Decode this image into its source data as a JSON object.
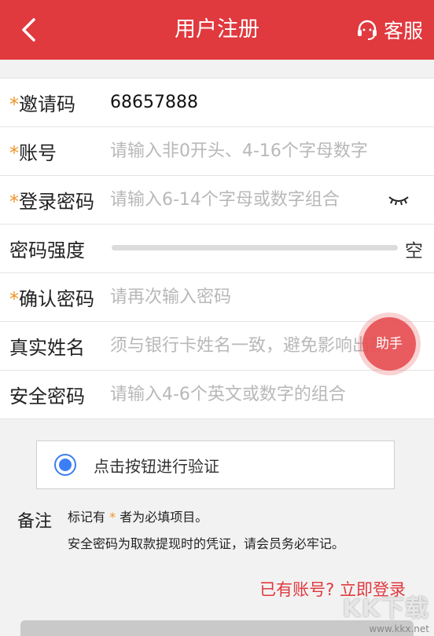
{
  "header": {
    "title": "用户注册",
    "service_label": "客服",
    "bg_color": "#e0393e"
  },
  "form": {
    "invite_code": {
      "star": "*",
      "label": "邀请码",
      "value": "68657888"
    },
    "account": {
      "star": "*",
      "label": "账号",
      "placeholder": "请输入非0开头、4-16个字母数字"
    },
    "password": {
      "star": "*",
      "label": "登录密码",
      "placeholder": "请输入6-14个字母或数字组合"
    },
    "strength": {
      "label": "密码强度",
      "status": "空"
    },
    "confirm_password": {
      "star": "*",
      "label": "确认密码",
      "placeholder": "请再次输入密码"
    },
    "real_name": {
      "label": "真实姓名",
      "placeholder": "须与银行卡姓名一致，避免影响出款"
    },
    "security_password": {
      "label": "安全密码",
      "placeholder": "请输入4-6个英文或数字的组合"
    }
  },
  "helper_button": {
    "label": "助手"
  },
  "verify": {
    "label": "点击按钮进行验证"
  },
  "notes": {
    "label": "备注",
    "line1_prefix": "标记有",
    "line1_star": "*",
    "line1_suffix": "者为必填项目。",
    "line2": "安全密码为取款提现时的凭证，请会员务必牢记。"
  },
  "login_link": "已有账号? 立即登录",
  "watermark": {
    "big": "KK下载",
    "small": "www.kkx.net"
  }
}
